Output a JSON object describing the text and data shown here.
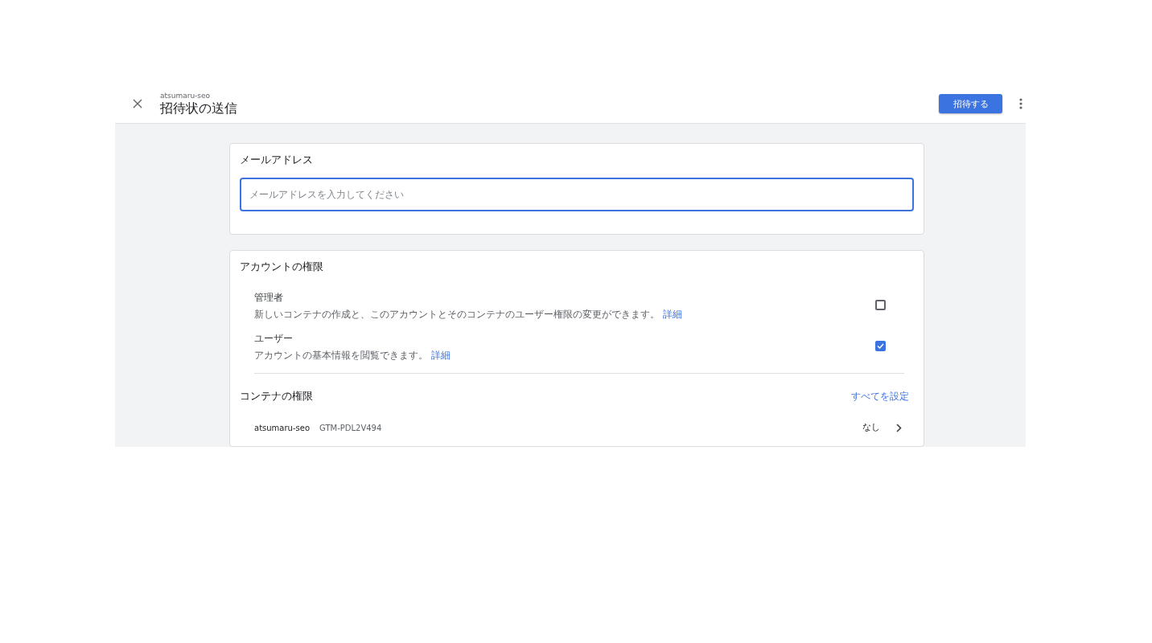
{
  "header": {
    "subtitle": "atsumaru-seo",
    "title": "招待状の送信",
    "invite_button": "招待する"
  },
  "email": {
    "label": "メールアドレス",
    "placeholder": "メールアドレスを入力してください"
  },
  "account_permissions": {
    "title": "アカウントの権限",
    "roles": [
      {
        "name": "管理者",
        "description": "新しいコンテナの作成と、このアカウントとそのコンテナのユーザー権限の変更ができます。",
        "link": "詳細",
        "checked": false
      },
      {
        "name": "ユーザー",
        "description": "アカウントの基本情報を閲覧できます。",
        "link": "詳細",
        "checked": true
      }
    ]
  },
  "container_permissions": {
    "title": "コンテナの権限",
    "set_all_link": "すべてを設定",
    "containers": [
      {
        "name": "atsumaru-seo",
        "id": "GTM-PDL2V494",
        "permission": "なし"
      }
    ]
  }
}
